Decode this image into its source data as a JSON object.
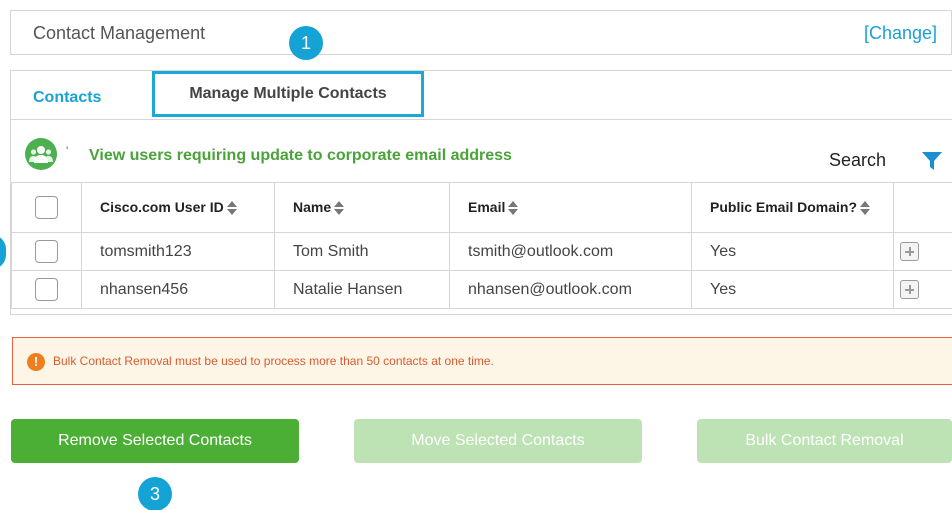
{
  "header": {
    "title": "Contact Management",
    "change_link": "[Change]"
  },
  "steps": {
    "step1": "1",
    "step3": "3"
  },
  "tabs": [
    {
      "label": "Contacts",
      "active": true
    },
    {
      "label": "Manage Multiple Contacts",
      "highlighted": true
    }
  ],
  "toolbar": {
    "users_icon": "users-icon",
    "tick": "'",
    "update_link": "View users requiring update to corporate email address",
    "search_label": "Search",
    "filter_icon": "filter-icon"
  },
  "table": {
    "columns": [
      "Cisco.com User ID",
      "Name",
      "Email",
      "Public Email Domain?"
    ],
    "rows": [
      {
        "user_id": "tomsmith123",
        "name": "Tom Smith",
        "email": "tsmith@outlook.com",
        "public_domain": "Yes"
      },
      {
        "user_id": "nhansen456",
        "name": "Natalie Hansen",
        "email": "nhansen@outlook.com",
        "public_domain": "Yes"
      }
    ]
  },
  "alert": {
    "icon_glyph": "!",
    "message": "Bulk Contact Removal must be used to process more than 50 contacts at one time."
  },
  "actions": {
    "remove_label": "Remove Selected Contacts",
    "move_label": "Move Selected Contacts",
    "bulk_label": "Bulk Contact Removal"
  },
  "colors": {
    "accent_blue": "#15a3d6",
    "link_green": "#4aa33a",
    "primary_green": "#4caf35",
    "disabled_green": "#bde2b3",
    "alert_border": "#e8623c",
    "alert_bg": "#fdf6e7"
  }
}
